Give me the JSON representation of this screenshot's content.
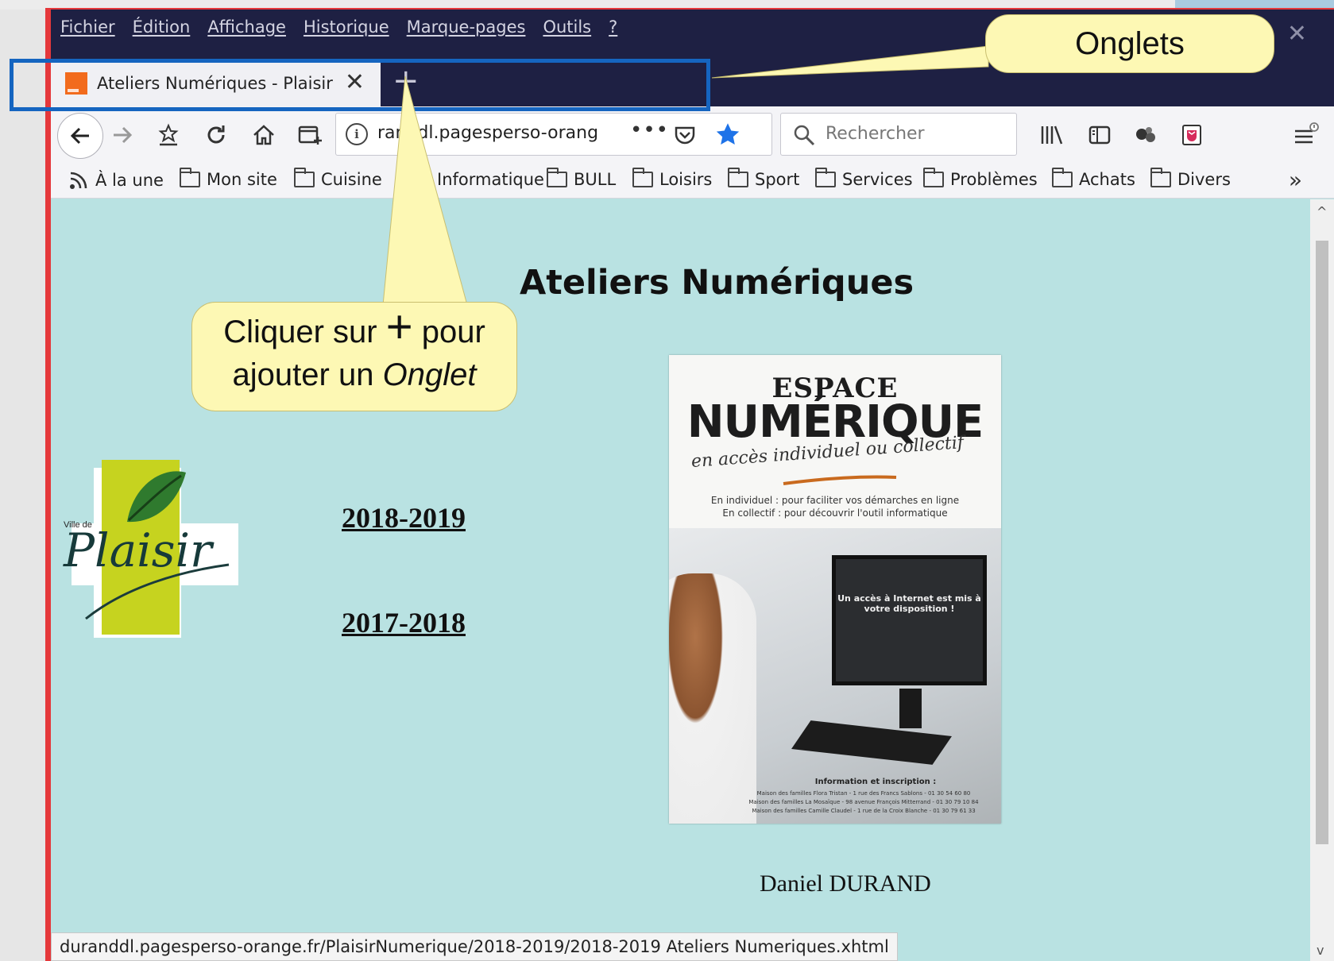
{
  "browser": {
    "menu": [
      "Fichier",
      "Édition",
      "Affichage",
      "Historique",
      "Marque-pages",
      "Outils",
      "?"
    ],
    "tab_title": "Ateliers Numériques - Plaisir",
    "url_visible": "randdl.pagesperso-orang",
    "search_placeholder": "Rechercher",
    "bookmarks": [
      "À la une",
      "Mon site",
      "Cuisine",
      "Informatique",
      "BULL",
      "Loisirs",
      "Sport",
      "Services",
      "Problèmes",
      "Achats",
      "Divers"
    ],
    "status_url": "duranddl.pagesperso-orange.fr/PlaisirNumerique/2018-2019/2018-2019 Ateliers Numeriques.xhtml"
  },
  "page": {
    "title": "Ateliers Numériques",
    "links": [
      "2018-2019",
      "2017-2018"
    ],
    "author": "Daniel DURAND",
    "logo": {
      "top": "Ville de",
      "name": "Plaisir"
    },
    "poster": {
      "title1": "ESPACE",
      "title2": "NUMÉRIQUE",
      "subtitle": "en accès individuel ou collectif",
      "line1": "En individuel : pour faciliter vos démarches en ligne",
      "line2": "En collectif : pour découvrir l'outil informatique",
      "screen_text": "Un accès à Internet est mis à votre disposition !",
      "info_title": "Information et inscription :",
      "info_lines": [
        "Maison des familles Flora Tristan - 1 rue des Francs Sablons - 01 30 54 60 80",
        "Maison des familles La Mosaïque - 98 avenue François Mitterrand - 01 30 79 10 84",
        "Maison des familles Camille Claudel - 1 rue de la Croix Blanche - 01 30 79 61 33"
      ]
    }
  },
  "annotations": {
    "onglets": "Onglets",
    "callout_line1_a": "Cliquer sur",
    "callout_plus": "+",
    "callout_line1_b": "pour",
    "callout_line2_a": "ajouter un",
    "callout_line2_b": "Onglet"
  },
  "colors": {
    "titlebar": "#1e2043",
    "page_background": "#b9e2e2",
    "highlight": "#1565c0",
    "callout": "#fdf8b4",
    "frame": "#e5383b"
  }
}
